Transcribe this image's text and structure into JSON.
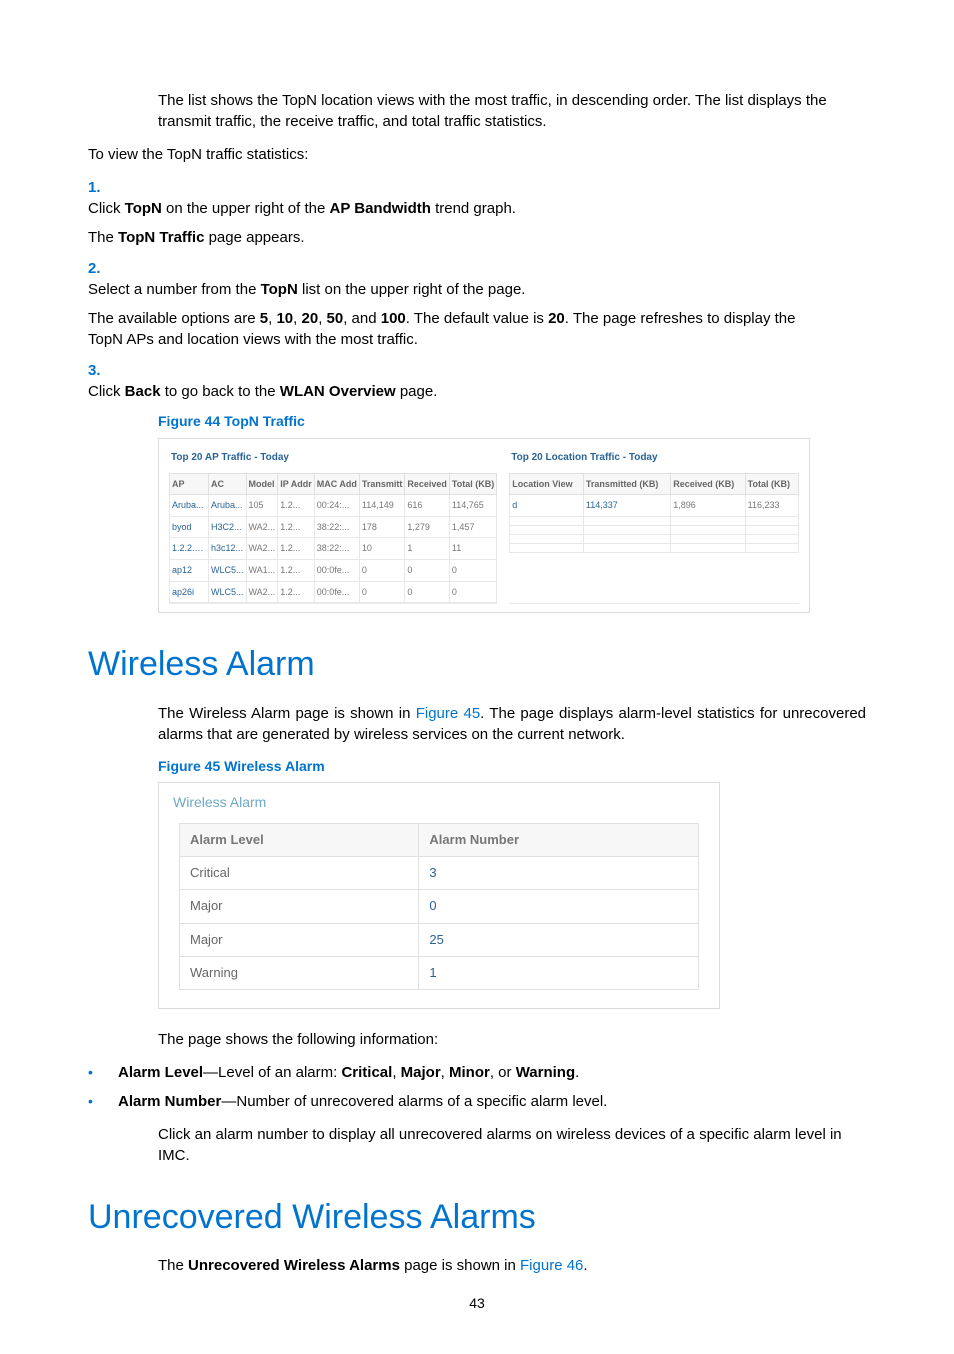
{
  "intro": {
    "p1": "The list shows the TopN location views with the most traffic, in descending order. The list displays the transmit traffic, the receive traffic, and total traffic statistics.",
    "p2": "To view the TopN traffic statistics:"
  },
  "steps": {
    "s1a": "Click ",
    "s1b": "TopN",
    "s1c": " on the upper right of the ",
    "s1d": "AP Bandwidth",
    "s1e": " trend graph.",
    "s1f": "The ",
    "s1g": "TopN Traffic",
    "s1h": " page appears.",
    "s2a": "Select a number from the ",
    "s2b": "TopN",
    "s2c": " list on the upper right of the page.",
    "s2d": "The available options are ",
    "s2e": "5",
    "s2f": ", ",
    "s2g": "10",
    "s2h": ", ",
    "s2i": "20",
    "s2j": ", ",
    "s2k": "50",
    "s2l": ", and ",
    "s2m": "100",
    "s2n": ". The default value is ",
    "s2o": "20",
    "s2p": ". The page refreshes to display the TopN APs and location views with the most traffic.",
    "s3a": "Click ",
    "s3b": "Back",
    "s3c": " to go back to the ",
    "s3d": "WLAN Overview",
    "s3e": " page."
  },
  "n1": "1.",
  "n2": "2.",
  "n3": "3.",
  "figure44": {
    "caption": "Figure 44 TopN Traffic",
    "left": {
      "title": "Top 20 AP Traffic - Today",
      "headers": [
        "AP",
        "AC",
        "Model",
        "IP Addr",
        "MAC Add",
        "Transmitt",
        "Received",
        "Total (KB)"
      ],
      "rows": [
        [
          "Aruba...",
          "Aruba...",
          "105",
          "1.2...",
          "00:24:...",
          "114,149",
          "616",
          "114,765"
        ],
        [
          "byod",
          "H3C2...",
          "WA2...",
          "1.2...",
          "38:22:...",
          "178",
          "1,279",
          "1,457"
        ],
        [
          "1.2.2.1...",
          "h3c12...",
          "WA2...",
          "1.2...",
          "38:22:...",
          "10",
          "1",
          "11"
        ],
        [
          "ap12",
          "WLC5...",
          "WA1...",
          "1.2...",
          "00:0fe...",
          "0",
          "0",
          "0"
        ],
        [
          "ap26i",
          "WLC5...",
          "WA2...",
          "1.2...",
          "00:0fe...",
          "0",
          "0",
          "0"
        ]
      ]
    },
    "right": {
      "title": "Top 20 Location Traffic - Today",
      "headers": [
        "Location View",
        "Transmitted (KB)",
        "Received (KB)",
        "Total (KB)"
      ],
      "rows": [
        [
          "d",
          "114,337",
          "1,896",
          "116,233"
        ],
        [
          "",
          "",
          "",
          ""
        ],
        [
          "",
          "",
          "",
          ""
        ],
        [
          "",
          "",
          "",
          ""
        ],
        [
          "",
          "",
          "",
          ""
        ]
      ]
    }
  },
  "wireless_alarm": {
    "h1": "Wireless Alarm",
    "p1a": "The Wireless Alarm page is shown in ",
    "p1link": "Figure 45",
    "p1b": ". The page displays alarm-level statistics for unrecovered alarms that are generated by wireless services on the current network.",
    "figcaption": "Figure 45 Wireless Alarm",
    "panel_title": "Wireless Alarm",
    "headers": [
      "Alarm Level",
      "Alarm Number"
    ],
    "rows": [
      [
        "Critical",
        "3"
      ],
      [
        "Major",
        "0"
      ],
      [
        "Major",
        "25"
      ],
      [
        "Warning",
        "1"
      ]
    ],
    "p2": "The page shows the following information:",
    "b1a": "Alarm Level",
    "b1b": "—Level of an alarm: ",
    "b1c": "Critical",
    "b1d": ", ",
    "b1e": "Major",
    "b1f": ", ",
    "b1g": "Minor",
    "b1h": ", or ",
    "b1i": "Warning",
    "b1j": ".",
    "b2a": "Alarm Number",
    "b2b": "—Number of unrecovered alarms of a specific alarm level.",
    "p3": "Click an alarm number to display all unrecovered alarms on wireless devices of a specific alarm level in IMC."
  },
  "unrecovered": {
    "h1": "Unrecovered Wireless Alarms",
    "p1a": "The ",
    "p1b": "Unrecovered Wireless Alarms",
    "p1c": " page is shown in ",
    "p1link": "Figure 46",
    "p1d": "."
  },
  "page_number": "43"
}
